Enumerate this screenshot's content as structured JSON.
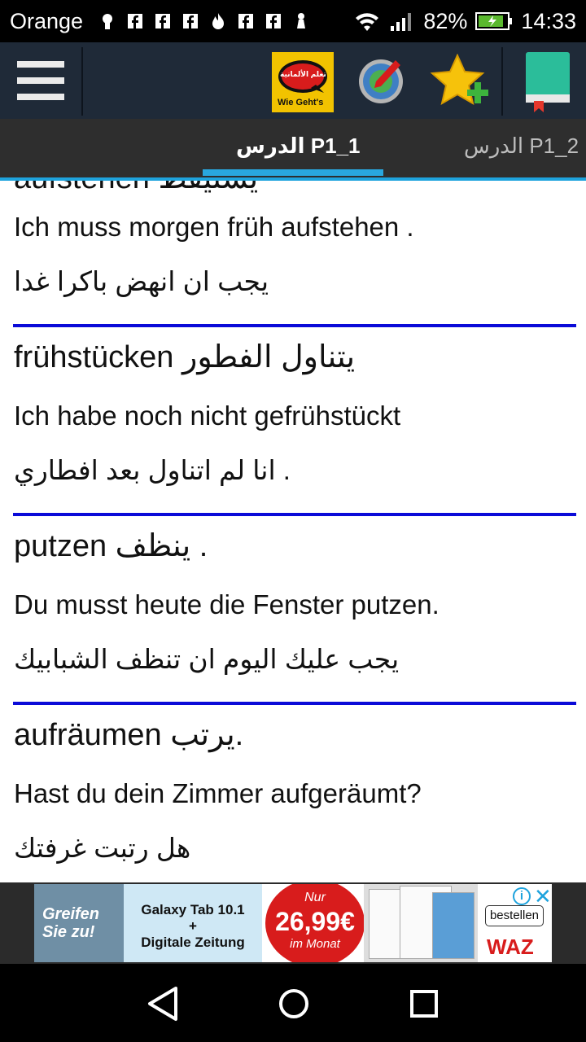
{
  "status_bar": {
    "carrier": "Orange",
    "battery": "82%",
    "time": "14:33"
  },
  "toolbar": {
    "logo_text": "Wie Geht's",
    "logo_arabic": "تعلم الألمانية"
  },
  "tabs": [
    {
      "label": "الدرس P1_1",
      "active": true
    },
    {
      "label": "الدرس P1_2",
      "active": false
    }
  ],
  "content": {
    "cut_top_word": "aufstehen يستيقظ",
    "first_entry": {
      "sentence_de": "Ich muss morgen früh aufstehen .",
      "sentence_ar": "يجب ان انهض باكرا غدا"
    },
    "entries": [
      {
        "word": "frühstücken يتناول الفطور",
        "sentence_de": "Ich habe noch nicht gefrühstückt",
        "sentence_ar": "انا لم اتناول بعد افطاري ."
      },
      {
        "word": "putzen ينظف .",
        "sentence_de": "Du musst heute die Fenster putzen.",
        "sentence_ar": "يجب عليك اليوم ان تنظف الشبابيك"
      },
      {
        "word": "aufräumen يرتب.",
        "sentence_de": "Hast du dein Zimmer aufgeräumt?",
        "sentence_ar": "هل رتبت غرفتك"
      }
    ]
  },
  "ad": {
    "left_text_1": "Greifen",
    "left_text_2": "Sie zu!",
    "mid_line_1": "Galaxy Tab 10.1",
    "mid_line_2": "+",
    "mid_line_3": "Digitale Zeitung",
    "price_top": "Nur",
    "price": "26,99€",
    "price_bottom": "im Monat",
    "button": "bestellen",
    "brand": "WAZ",
    "info_icon": "i",
    "close_icon": "✕"
  },
  "colors": {
    "toolbar_bg": "#1f2a38",
    "tabs_bg": "#2e2e2e",
    "tab_indicator": "#29a7df",
    "separator": "#0b0bd8"
  }
}
